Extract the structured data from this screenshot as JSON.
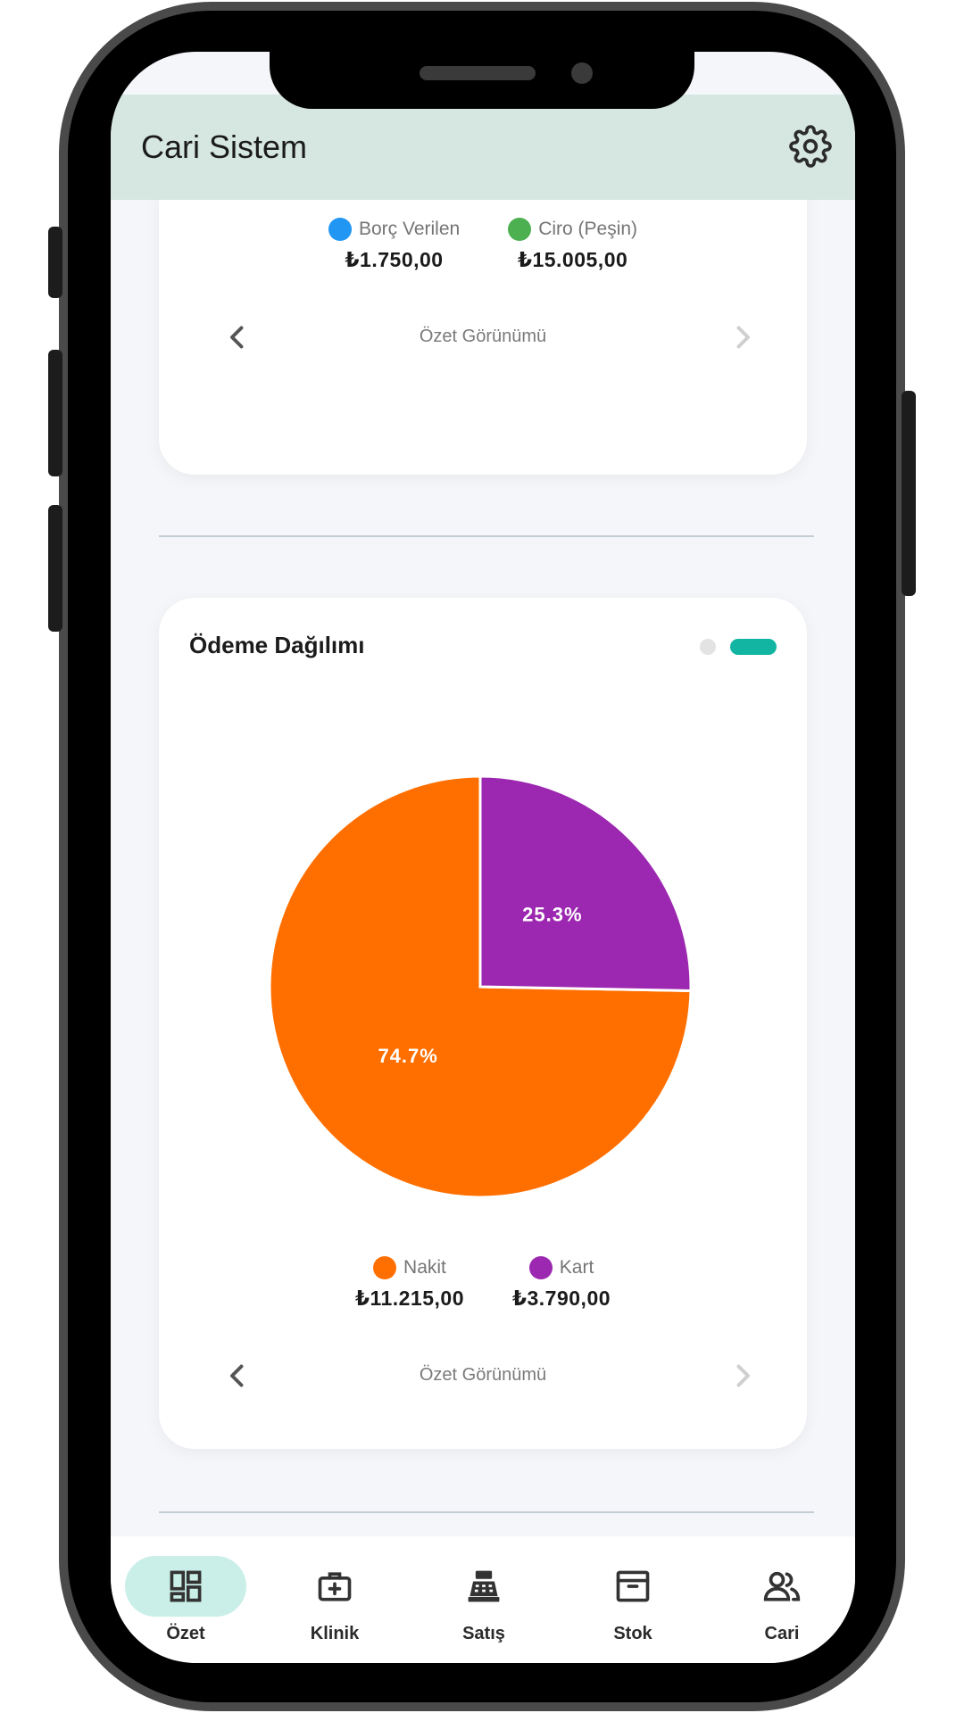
{
  "app": {
    "title": "Cari Sistem"
  },
  "header": {
    "settings_icon": "gear-icon"
  },
  "summary_card": {
    "legend": [
      {
        "label": "Borç Verilen",
        "value": "₺1.750,00",
        "color": "#2196f3"
      },
      {
        "label": "Ciro (Peşin)",
        "value": "₺15.005,00",
        "color": "#4caf50"
      }
    ],
    "nav_label": "Özet Görünümü"
  },
  "payment_card": {
    "title": "Ödeme Dağılımı",
    "legend": [
      {
        "label": "Nakit",
        "value": "₺11.215,00",
        "color": "#ff6f00"
      },
      {
        "label": "Kart",
        "value": "₺3.790,00",
        "color": "#9c27b0"
      }
    ],
    "nav_label": "Özet Görünümü",
    "pager": {
      "pages": 2,
      "active": 2,
      "active_color": "#11b5a2"
    }
  },
  "chart_data": {
    "type": "pie",
    "title": "Ödeme Dağılımı",
    "series": [
      {
        "name": "Nakit",
        "values": [
          74.7
        ],
        "label": "74.7%",
        "color": "#ff6f00"
      },
      {
        "name": "Kart",
        "values": [
          25.3
        ],
        "label": "25.3%",
        "color": "#9c27b0"
      }
    ],
    "legend": "bottom"
  },
  "bottom_nav": {
    "items": [
      {
        "label": "Özet",
        "icon": "dashboard-icon",
        "active": true
      },
      {
        "label": "Klinik",
        "icon": "medical-kit-icon",
        "active": false
      },
      {
        "label": "Satış",
        "icon": "cash-register-icon",
        "active": false
      },
      {
        "label": "Stok",
        "icon": "archive-box-icon",
        "active": false
      },
      {
        "label": "Cari",
        "icon": "people-icon",
        "active": false
      }
    ],
    "active_color": "#c9efe8"
  }
}
